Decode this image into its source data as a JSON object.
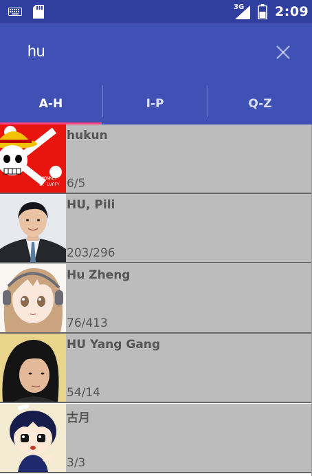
{
  "status_bar": {
    "network": "3G",
    "time": "2:09",
    "icons": [
      "keyboard-icon",
      "sd-card-icon",
      "signal-icon",
      "battery-icon"
    ]
  },
  "search": {
    "value": "hu",
    "placeholder": "",
    "clear_icon": "close-icon"
  },
  "tabs": [
    {
      "label": "A-H",
      "active": true
    },
    {
      "label": "I-P",
      "active": false
    },
    {
      "label": "Q-Z",
      "active": false
    }
  ],
  "contacts": [
    {
      "name": "hukun",
      "count": "6/5",
      "avatar": "one-piece-jolly-roger-avatar",
      "avatar_text": "MONKEY D. LUFFY"
    },
    {
      "name": "HU, Pili",
      "count": "203/296",
      "avatar": "man-in-suit-photo-avatar"
    },
    {
      "name": "Hu Zheng",
      "count": "76/413",
      "avatar": "anime-girl-headphones-avatar"
    },
    {
      "name": "HU Yang Gang",
      "count": "54/14",
      "avatar": "person-dark-hair-photo-avatar"
    },
    {
      "name": "古月",
      "count": "3/3",
      "avatar": "cartoon-boy-avatar"
    }
  ],
  "colors": {
    "status_bar": "#303f9f",
    "toolbar": "#3f51b5",
    "tab_indicator": "#ff4081",
    "row_background": "#bcbcbc",
    "row_text": "#555555"
  }
}
